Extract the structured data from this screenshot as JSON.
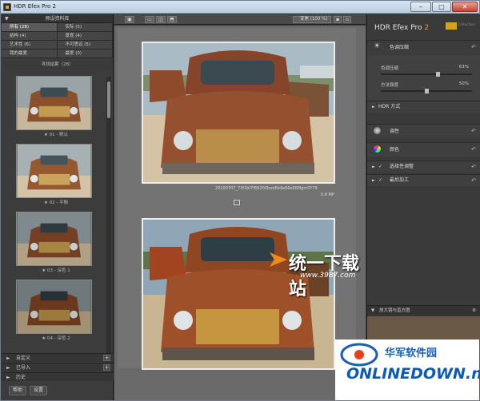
{
  "window": {
    "title": "HDR Efex Pro 2",
    "buttons": {
      "minimize": "–",
      "maximize": "□",
      "close": "✕"
    }
  },
  "left_panel": {
    "header": "预设资料库",
    "categories": [
      {
        "label": "所有 (28)",
        "active": true
      },
      {
        "label": "实际 (5)",
        "active": false
      },
      {
        "label": "结构 (4)",
        "active": false
      },
      {
        "label": "景观 (4)",
        "active": false
      },
      {
        "label": "艺术性 (6)",
        "active": false
      },
      {
        "label": "不可思议 (5)",
        "active": false
      },
      {
        "label": "我的最爱",
        "active": false
      },
      {
        "label": "最爱 (0)",
        "active": false
      }
    ],
    "results_label": "寻找结果（28）",
    "thumbnails": [
      {
        "caption": "★ 01 - 默认"
      },
      {
        "caption": "★ 02 - 平衡"
      },
      {
        "caption": "★ 03 - 深色 1"
      },
      {
        "caption": "★ 04 - 深色 2"
      }
    ],
    "sections": [
      {
        "label": "自定义"
      },
      {
        "label": "已导入"
      },
      {
        "label": "历史"
      }
    ],
    "bottom_buttons": {
      "help": "帮助",
      "settings": "设置"
    }
  },
  "toolbar": {
    "zoom_label": "变焦 (100 %)"
  },
  "center": {
    "filename": "20100707_73f2bf7f66200bed6b4e66e66Mgm0Y79",
    "filesize": "0.8 MP"
  },
  "watermark": {
    "cn": "统一下载站",
    "url": "www.3987.com"
  },
  "right_panel": {
    "brand": "HDR Efex Pro",
    "brand_version": "2",
    "collection": "Collection",
    "tone_compression": {
      "title": "色调压缩",
      "sliders": [
        {
          "label": "色调压缩",
          "value_text": "63%",
          "value": 0.63
        },
        {
          "label": "方法强度",
          "value_text": "50%",
          "value": 0.5
        }
      ]
    },
    "hdr_method": "HDR 方式",
    "rows": [
      {
        "label": "调性"
      },
      {
        "label": "颜色"
      },
      {
        "label": "选择性调整"
      },
      {
        "label": "最后加工"
      }
    ],
    "loupe": "放大镜与直方图"
  },
  "site_logo": {
    "cn": "华军软件园",
    "en": "ONLINEDOWN.net"
  }
}
